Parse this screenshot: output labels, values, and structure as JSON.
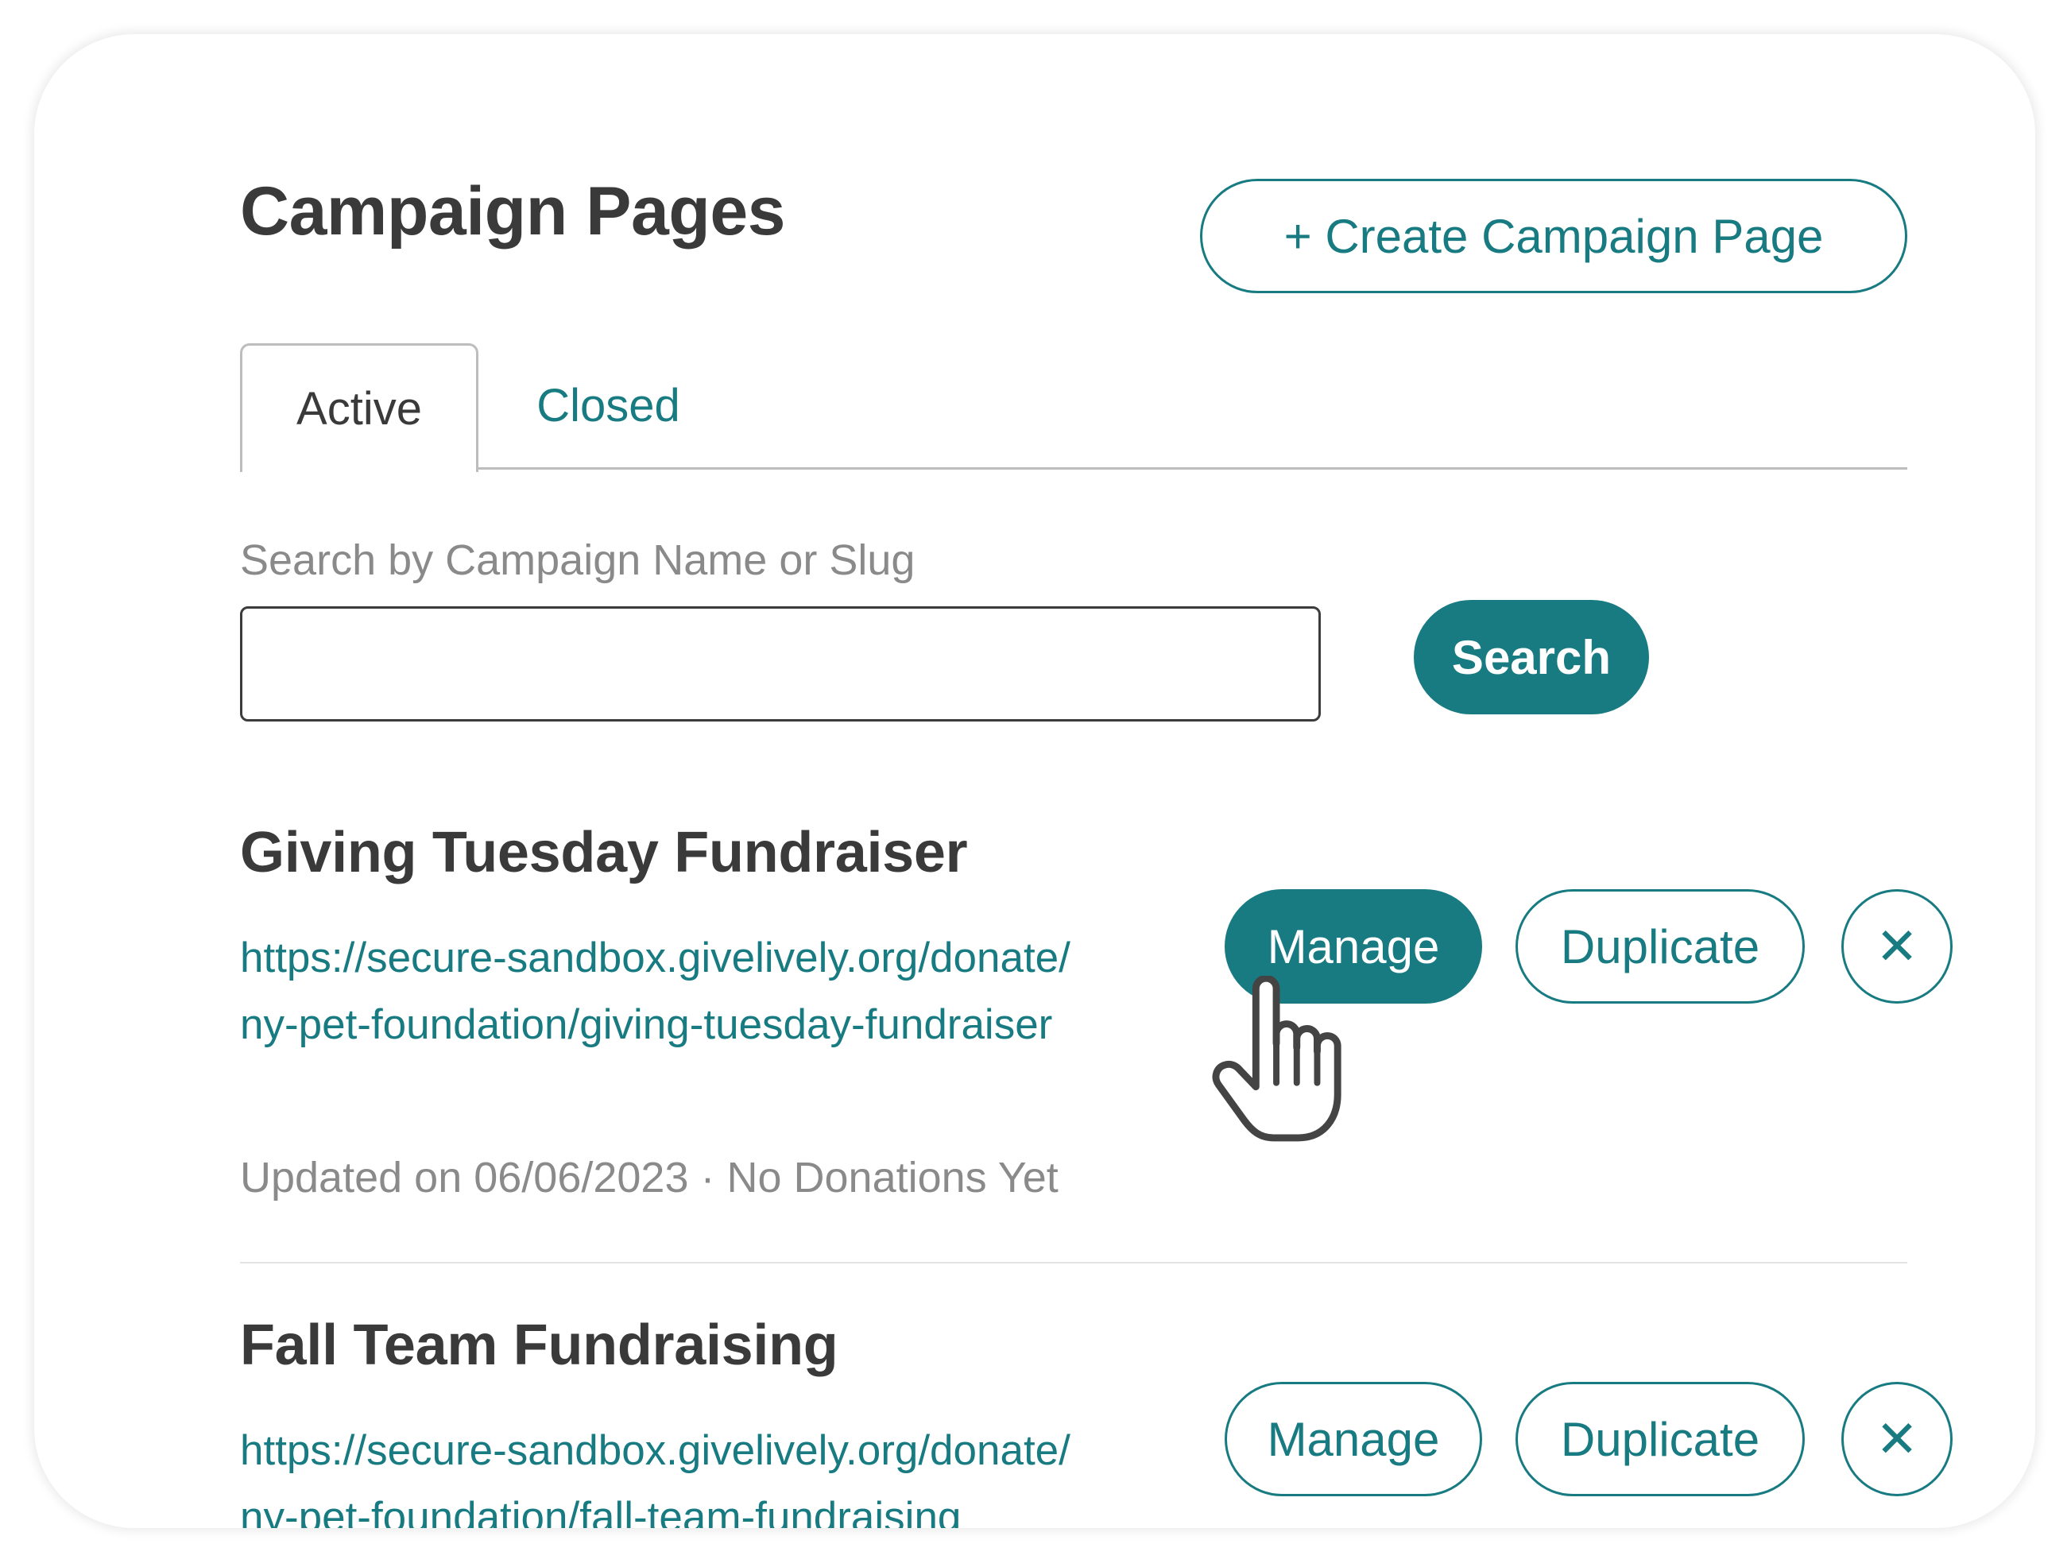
{
  "header": {
    "title": "Campaign Pages",
    "create_button_label": "+ Create Campaign Page"
  },
  "tabs": [
    {
      "label": "Active",
      "selected": true
    },
    {
      "label": "Closed",
      "selected": false
    }
  ],
  "search": {
    "label": "Search by Campaign Name or Slug",
    "value": "",
    "button_label": "Search"
  },
  "campaigns": [
    {
      "title": "Giving Tuesday Fundraiser",
      "url": "https://secure-sandbox.givelively.org/donate/ny-pet-foundation/giving-tuesday-fundraiser",
      "meta": "Updated on 06/06/2023 · No Donations Yet",
      "manage_label": "Manage",
      "duplicate_label": "Duplicate",
      "close_icon": "x-icon"
    },
    {
      "title": "Fall Team Fundraising",
      "url": "https://secure-sandbox.givelively.org/donate/ny-pet-foundation/fall-team-fundraising",
      "manage_label": "Manage",
      "duplicate_label": "Duplicate",
      "close_icon": "x-icon"
    }
  ],
  "colors": {
    "accent": "#187b82",
    "title_text": "#3a3a3a",
    "muted_text": "#8a8a8a",
    "border": "#bdbdbd"
  }
}
